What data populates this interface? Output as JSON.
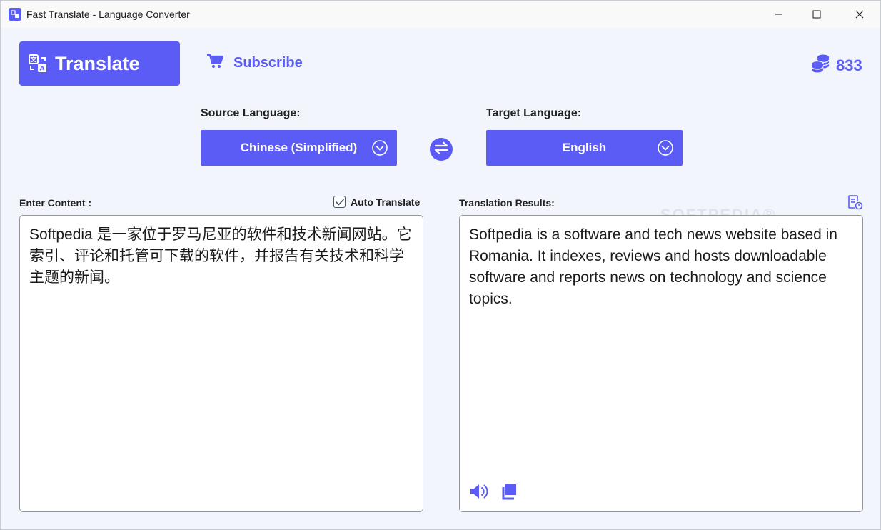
{
  "window": {
    "title": "Fast Translate - Language Converter"
  },
  "header": {
    "translate_label": "Translate",
    "subscribe_label": "Subscribe",
    "coin_count": "833"
  },
  "languages": {
    "source_label": "Source Language:",
    "source_value": "Chinese (Simplified)",
    "target_label": "Target Language:",
    "target_value": "English"
  },
  "input": {
    "label": "Enter Content :",
    "auto_translate_label": "Auto Translate",
    "auto_translate_checked": true,
    "text": "Softpedia 是一家位于罗马尼亚的软件和技术新闻网站。它索引、评论和托管可下载的软件，并报告有关技术和科学主题的新闻。"
  },
  "output": {
    "label": "Translation Results:",
    "text": "Softpedia is a software and tech news website based in Romania. It indexes, reviews and hosts downloadable software and reports news on technology and science topics."
  },
  "watermark": "SOFTPEDIA®",
  "colors": {
    "accent": "#5b5cf5",
    "background": "#f2f6fc"
  },
  "icons": {
    "app": "translate-app-icon",
    "translate": "translate-icon",
    "subscribe": "cart-icon",
    "coins": "coins-icon",
    "swap": "swap-icon",
    "history": "history-icon",
    "speak": "speaker-icon",
    "copy": "copy-icon"
  }
}
